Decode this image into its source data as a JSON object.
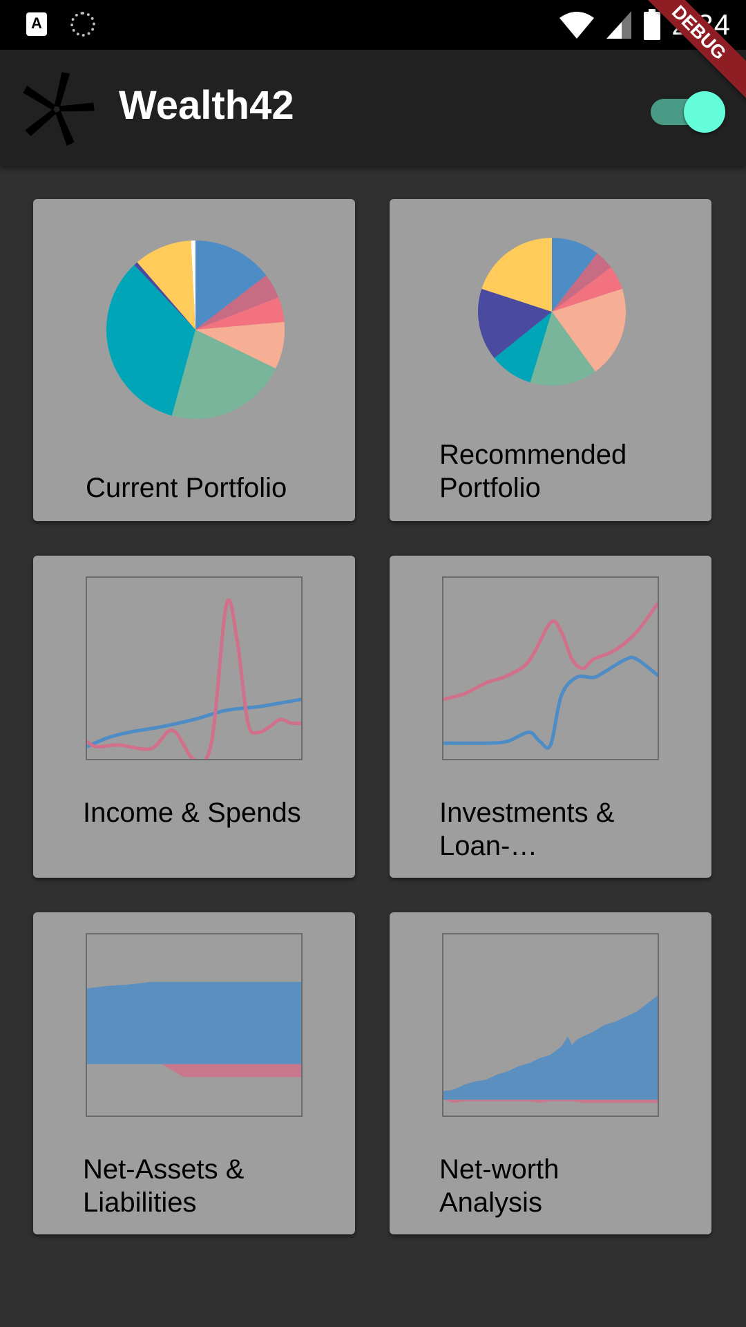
{
  "status_bar": {
    "time": "2:34",
    "icons": [
      "a-notification-icon",
      "loading-spinner-icon",
      "wifi-icon",
      "cell-signal-icon",
      "battery-icon"
    ]
  },
  "app_bar": {
    "title": "Wealth42",
    "logo_icon": "pinwheel-logo-icon",
    "theme_toggle_on": true,
    "debug_banner": "DEBUG"
  },
  "colors": {
    "background": "#303030",
    "app_bar": "#212121",
    "card": "#9e9e9e",
    "toggle_thumb": "#64ffda",
    "toggle_track": "#4a9b85",
    "series_blue": "#4e8cc6",
    "series_pink": "#d0708a"
  },
  "cards": {
    "current_portfolio": {
      "label": "Current Portfolio"
    },
    "recommended_portfolio": {
      "label": "Recommended Portfolio"
    },
    "income_spends": {
      "label": "Income & Spends"
    },
    "investments_loans": {
      "label": "Investments & Loan-…"
    },
    "net_assets": {
      "label": "Net-Assets & Liabilities"
    },
    "net_worth": {
      "label": "Net-worth Analysis"
    }
  },
  "chart_data": [
    {
      "id": "current_portfolio",
      "type": "pie",
      "slices": [
        {
          "value": 14.5,
          "color": "#4e8cc6"
        },
        {
          "value": 4.5,
          "color": "#c86b84"
        },
        {
          "value": 4.5,
          "color": "#f2737f"
        },
        {
          "value": 8.5,
          "color": "#f6af95"
        },
        {
          "value": 22,
          "color": "#79b59a"
        },
        {
          "value": 33.5,
          "color": "#00a6b8"
        },
        {
          "value": 0.7,
          "color": "#4a4aa0"
        },
        {
          "value": 10.5,
          "color": "#ffcb5a"
        },
        {
          "value": 0.8,
          "color": "#ffffff"
        }
      ]
    },
    {
      "id": "recommended_portfolio",
      "type": "pie",
      "slices": [
        {
          "value": 10,
          "color": "#4e8cc6"
        },
        {
          "value": 4,
          "color": "#c86b84"
        },
        {
          "value": 5,
          "color": "#f2737f"
        },
        {
          "value": 19,
          "color": "#f6af95"
        },
        {
          "value": 14,
          "color": "#79b59a"
        },
        {
          "value": 9,
          "color": "#00a6b8"
        },
        {
          "value": 15,
          "color": "#4a4aa0"
        },
        {
          "value": 19,
          "color": "#ffcb5a"
        }
      ]
    },
    {
      "id": "income_spends",
      "type": "line",
      "xlim": [
        0,
        100
      ],
      "ylim": [
        0,
        100
      ],
      "series": [
        {
          "color": "#4e8cc6",
          "x": [
            0,
            10,
            20,
            35,
            50,
            65,
            80,
            90,
            100
          ],
          "y": [
            7,
            12,
            15,
            18,
            22,
            27,
            29,
            31,
            33
          ]
        },
        {
          "color": "#d0708a",
          "x": [
            0,
            5,
            15,
            30,
            40,
            50,
            58,
            65,
            70,
            75,
            80,
            85,
            90,
            95,
            100
          ],
          "y": [
            10,
            7,
            8,
            6,
            16,
            0,
            9,
            85,
            65,
            20,
            15,
            18,
            22,
            20,
            20
          ]
        }
      ]
    },
    {
      "id": "investments_loans",
      "type": "line",
      "xlim": [
        0,
        100
      ],
      "ylim": [
        0,
        100
      ],
      "series": [
        {
          "color": "#4e8cc6",
          "x": [
            0,
            20,
            30,
            40,
            45,
            50,
            55,
            62,
            70,
            75,
            85,
            90,
            100
          ],
          "y": [
            9,
            9,
            10,
            15,
            10,
            8,
            35,
            45,
            45,
            48,
            55,
            55,
            46
          ]
        },
        {
          "color": "#d0708a",
          "x": [
            0,
            10,
            20,
            30,
            40,
            50,
            55,
            60,
            65,
            70,
            80,
            90,
            100
          ],
          "y": [
            33,
            36,
            42,
            46,
            54,
            75,
            70,
            55,
            50,
            55,
            60,
            70,
            86
          ]
        }
      ]
    },
    {
      "id": "net_assets",
      "type": "area",
      "xlim": [
        0,
        100
      ],
      "ylim": [
        -40,
        100
      ],
      "series": [
        {
          "color": "#4e8cc6",
          "x": [
            0,
            10,
            20,
            30,
            40,
            50,
            60,
            70,
            80,
            90,
            100
          ],
          "y": [
            58,
            60,
            61,
            63,
            63,
            63,
            63,
            63,
            63,
            63,
            63
          ]
        },
        {
          "color": "#d0708a",
          "x": [
            0,
            35,
            45,
            50,
            60,
            70,
            80,
            90,
            100
          ],
          "y": [
            0,
            0,
            -10,
            -10,
            -10,
            -10,
            -10,
            -10,
            -10
          ]
        }
      ]
    },
    {
      "id": "net_worth",
      "type": "area",
      "xlim": [
        0,
        100
      ],
      "ylim": [
        -10,
        100
      ],
      "series": [
        {
          "color": "#4e8cc6",
          "x": [
            0,
            5,
            10,
            15,
            20,
            25,
            30,
            35,
            40,
            45,
            50,
            55,
            58,
            60,
            62,
            65,
            70,
            75,
            80,
            85,
            90,
            95,
            100
          ],
          "y": [
            5,
            6,
            9,
            11,
            12,
            15,
            17,
            20,
            22,
            25,
            27,
            32,
            38,
            33,
            36,
            38,
            41,
            45,
            47,
            50,
            53,
            58,
            63
          ]
        },
        {
          "color": "#d0708a",
          "x": [
            0,
            5,
            10,
            40,
            45,
            50,
            60,
            65,
            70,
            100
          ],
          "y": [
            0,
            -2,
            -1,
            -1,
            -2,
            -1,
            -1,
            -2,
            -2,
            -2
          ]
        }
      ]
    }
  ]
}
